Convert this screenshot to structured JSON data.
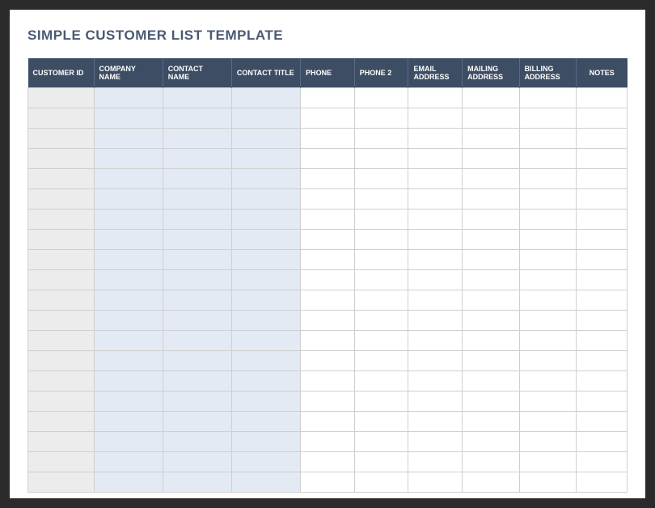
{
  "title": "SIMPLE CUSTOMER LIST TEMPLATE",
  "columns": [
    "CUSTOMER ID",
    "COMPANY NAME",
    "CONTACT NAME",
    "CONTACT TITLE",
    "PHONE",
    "PHONE 2",
    "EMAIL ADDRESS",
    "MAILING ADDRESS",
    "BILLING ADDRESS",
    "NOTES"
  ],
  "rows": [
    [
      "",
      "",
      "",
      "",
      "",
      "",
      "",
      "",
      "",
      ""
    ],
    [
      "",
      "",
      "",
      "",
      "",
      "",
      "",
      "",
      "",
      ""
    ],
    [
      "",
      "",
      "",
      "",
      "",
      "",
      "",
      "",
      "",
      ""
    ],
    [
      "",
      "",
      "",
      "",
      "",
      "",
      "",
      "",
      "",
      ""
    ],
    [
      "",
      "",
      "",
      "",
      "",
      "",
      "",
      "",
      "",
      ""
    ],
    [
      "",
      "",
      "",
      "",
      "",
      "",
      "",
      "",
      "",
      ""
    ],
    [
      "",
      "",
      "",
      "",
      "",
      "",
      "",
      "",
      "",
      ""
    ],
    [
      "",
      "",
      "",
      "",
      "",
      "",
      "",
      "",
      "",
      ""
    ],
    [
      "",
      "",
      "",
      "",
      "",
      "",
      "",
      "",
      "",
      ""
    ],
    [
      "",
      "",
      "",
      "",
      "",
      "",
      "",
      "",
      "",
      ""
    ],
    [
      "",
      "",
      "",
      "",
      "",
      "",
      "",
      "",
      "",
      ""
    ],
    [
      "",
      "",
      "",
      "",
      "",
      "",
      "",
      "",
      "",
      ""
    ],
    [
      "",
      "",
      "",
      "",
      "",
      "",
      "",
      "",
      "",
      ""
    ],
    [
      "",
      "",
      "",
      "",
      "",
      "",
      "",
      "",
      "",
      ""
    ],
    [
      "",
      "",
      "",
      "",
      "",
      "",
      "",
      "",
      "",
      ""
    ],
    [
      "",
      "",
      "",
      "",
      "",
      "",
      "",
      "",
      "",
      ""
    ],
    [
      "",
      "",
      "",
      "",
      "",
      "",
      "",
      "",
      "",
      ""
    ],
    [
      "",
      "",
      "",
      "",
      "",
      "",
      "",
      "",
      "",
      ""
    ],
    [
      "",
      "",
      "",
      "",
      "",
      "",
      "",
      "",
      "",
      ""
    ],
    [
      "",
      "",
      "",
      "",
      "",
      "",
      "",
      "",
      "",
      ""
    ]
  ]
}
